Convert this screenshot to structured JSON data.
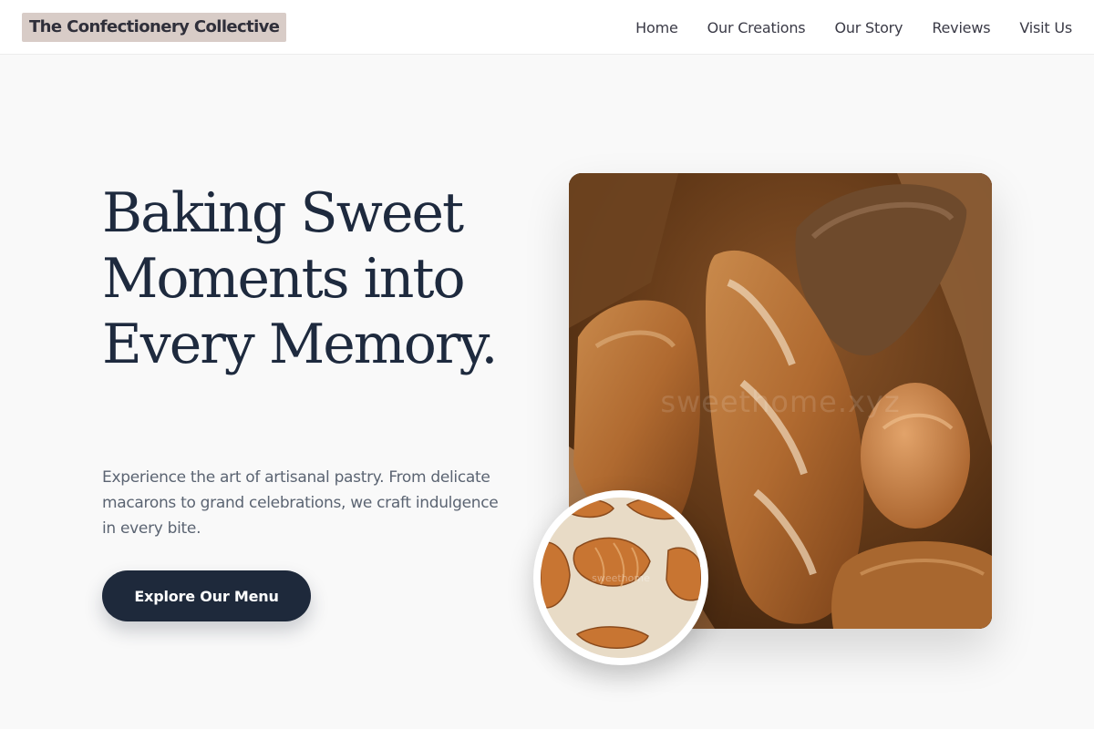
{
  "header": {
    "logo": "The Confectionery Collective",
    "nav": [
      "Home",
      "Our Creations",
      "Our Story",
      "Reviews",
      "Visit Us"
    ]
  },
  "hero": {
    "headline": "Baking Sweet Moments into Every Memory.",
    "subtitle": "Experience the art of artisanal pastry. From delicate macarons to grand celebrations, we craft indulgence in every bite.",
    "cta": "Explore Our Menu",
    "image_watermark": "sweethome.xyz",
    "inset_watermark": "sweethome"
  },
  "colors": {
    "background": "#f9f9f9",
    "primary": "#1e293b",
    "logo_highlight": "#d8ccc7"
  }
}
